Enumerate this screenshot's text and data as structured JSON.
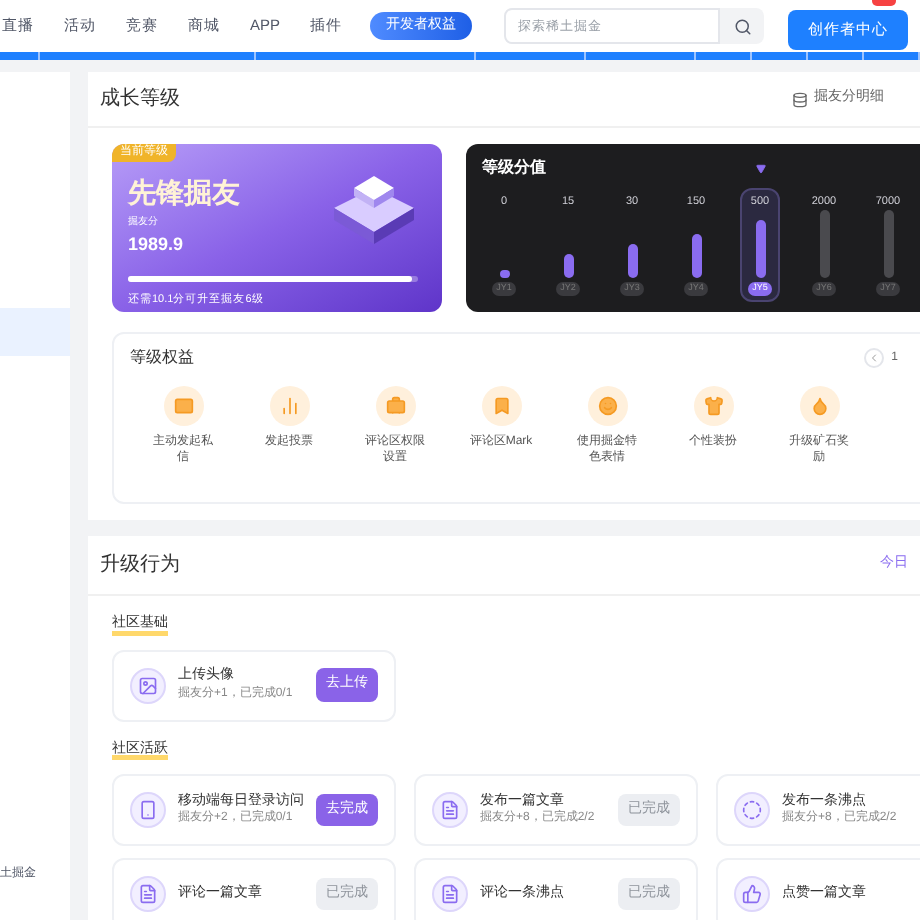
{
  "nav": {
    "links": [
      "直播",
      "活动",
      "竞赛",
      "商城",
      "APP",
      "插件"
    ],
    "promo": "开发者权益",
    "search": {
      "placeholder": "探索稀土掘金"
    },
    "creator_button": "创作者中心"
  },
  "sidebar": {
    "items": [
      {
        "selected": true
      }
    ],
    "footer": "土掘金"
  },
  "growth": {
    "title": "成长等级",
    "detail_link": "掘友分明细",
    "rank_card": {
      "tag": "当前等级",
      "name": "先锋掘友",
      "score_label": "掘友分",
      "score": "1989.9",
      "level": 0.98,
      "hint": "还需10.1分可升至掘友6级"
    },
    "levels_card": {
      "title": "等级分值",
      "levels": [
        {
          "value": "0",
          "label": "JY1",
          "selected": false,
          "reached": true
        },
        {
          "value": "15",
          "label": "JY2",
          "selected": false,
          "reached": true
        },
        {
          "value": "30",
          "label": "JY3",
          "selected": false,
          "reached": true
        },
        {
          "value": "150",
          "label": "JY4",
          "selected": false,
          "reached": true
        },
        {
          "value": "500",
          "label": "JY5",
          "selected": true,
          "reached": true
        },
        {
          "value": "2000",
          "label": "JY6",
          "selected": false,
          "reached": false
        },
        {
          "value": "7000",
          "label": "JY7",
          "selected": false,
          "reached": false
        }
      ]
    },
    "benefits": {
      "title": "等级权益",
      "page": "1",
      "items": [
        {
          "label": "主动发起私信",
          "kind": "mail"
        },
        {
          "label": "发起投票",
          "kind": "chart"
        },
        {
          "label": "评论区权限设置",
          "kind": "bag"
        },
        {
          "label": "评论区Mark",
          "kind": "bookmark"
        },
        {
          "label": "使用掘金特色表情",
          "kind": "smile"
        },
        {
          "label": "个性装扮",
          "kind": "shirt"
        },
        {
          "label": "升级矿石奖励",
          "kind": "drop"
        }
      ]
    }
  },
  "actions": {
    "title": "升级行为",
    "link": "今日",
    "groups": [
      {
        "title": "社区基础",
        "tasks": [
          {
            "name": "上传头像",
            "reward": "掘友分+1，已完成0/1",
            "button": "去上传",
            "done": false,
            "kind": "image"
          }
        ]
      },
      {
        "title": "社区活跃",
        "tasks": [
          {
            "name": "移动端每日登录访问",
            "reward": "掘友分+2，已完成0/1",
            "button": "去完成",
            "done": false,
            "kind": "phone"
          },
          {
            "name": "发布一篇文章",
            "reward": "掘友分+8，已完成2/2",
            "button": "已完成",
            "done": true,
            "kind": "doc"
          },
          {
            "name": "发布一条沸点",
            "reward": "掘友分+8，已完成2/2",
            "kind": "ring"
          },
          {
            "name": "评论一篇文章",
            "button": "已完成",
            "done": true,
            "kind": "doc"
          },
          {
            "name": "评论一条沸点",
            "button": "已完成",
            "done": true,
            "kind": "doc"
          },
          {
            "name": "点赞一篇文章",
            "kind": "thumb"
          }
        ]
      }
    ]
  }
}
